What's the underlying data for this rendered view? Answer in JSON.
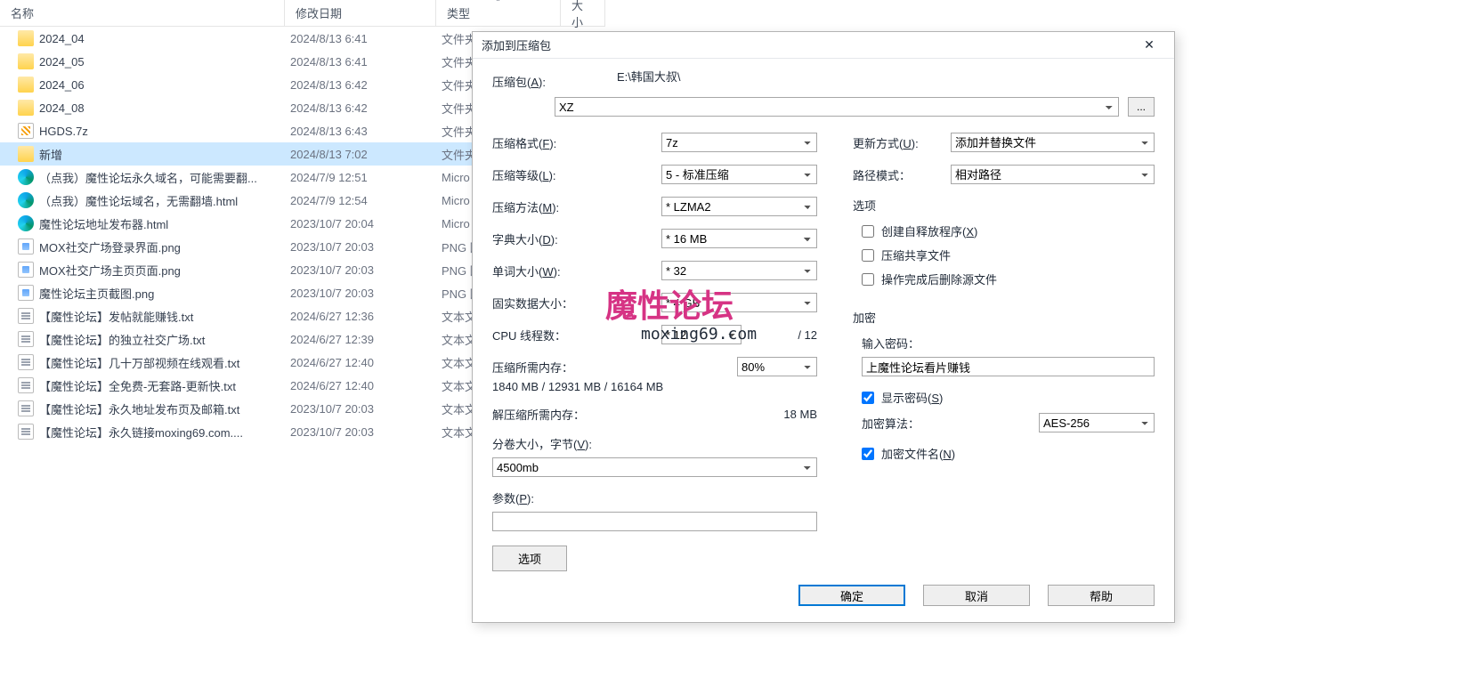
{
  "explorer": {
    "columns": {
      "name": "名称",
      "date": "修改日期",
      "type": "类型",
      "size": "大小"
    },
    "rows": [
      {
        "icon": "folder",
        "name": "2024_04",
        "date": "2024/8/13 6:41",
        "type": "文件夹",
        "sel": false
      },
      {
        "icon": "folder",
        "name": "2024_05",
        "date": "2024/8/13 6:41",
        "type": "文件夹",
        "sel": false
      },
      {
        "icon": "folder",
        "name": "2024_06",
        "date": "2024/8/13 6:42",
        "type": "文件夹",
        "sel": false
      },
      {
        "icon": "folder",
        "name": "2024_08",
        "date": "2024/8/13 6:42",
        "type": "文件夹",
        "sel": false
      },
      {
        "icon": "7z",
        "name": "HGDS.7z",
        "date": "2024/8/13 6:43",
        "type": "文件夹",
        "sel": false
      },
      {
        "icon": "folder",
        "name": "新增",
        "date": "2024/8/13 7:02",
        "type": "文件夹",
        "sel": true
      },
      {
        "icon": "edge",
        "name": "（点我）魔性论坛永久域名，可能需要翻...",
        "date": "2024/7/9 12:51",
        "type": "Micro",
        "sel": false
      },
      {
        "icon": "edge",
        "name": "（点我）魔性论坛域名，无需翻墙.html",
        "date": "2024/7/9 12:54",
        "type": "Micro",
        "sel": false
      },
      {
        "icon": "edge",
        "name": "魔性论坛地址发布器.html",
        "date": "2023/10/7 20:04",
        "type": "Micro",
        "sel": false
      },
      {
        "icon": "png",
        "name": "MOX社交广场登录界面.png",
        "date": "2023/10/7 20:03",
        "type": "PNG 图",
        "sel": false
      },
      {
        "icon": "png",
        "name": "MOX社交广场主页页面.png",
        "date": "2023/10/7 20:03",
        "type": "PNG 图",
        "sel": false
      },
      {
        "icon": "png",
        "name": "魔性论坛主页截图.png",
        "date": "2023/10/7 20:03",
        "type": "PNG 图",
        "sel": false
      },
      {
        "icon": "txt",
        "name": "【魔性论坛】发帖就能赚钱.txt",
        "date": "2024/6/27 12:36",
        "type": "文本文",
        "sel": false
      },
      {
        "icon": "txt",
        "name": "【魔性论坛】的独立社交广场.txt",
        "date": "2024/6/27 12:39",
        "type": "文本文",
        "sel": false
      },
      {
        "icon": "txt",
        "name": "【魔性论坛】几十万部视频在线观看.txt",
        "date": "2024/6/27 12:40",
        "type": "文本文",
        "sel": false
      },
      {
        "icon": "txt",
        "name": "【魔性论坛】全免费-无套路-更新快.txt",
        "date": "2024/6/27 12:40",
        "type": "文本文",
        "sel": false
      },
      {
        "icon": "txt",
        "name": "【魔性论坛】永久地址发布页及邮箱.txt",
        "date": "2023/10/7 20:03",
        "type": "文本文",
        "sel": false
      },
      {
        "icon": "txt",
        "name": "【魔性论坛】永久链接moxing69.com....",
        "date": "2023/10/7 20:03",
        "type": "文本文",
        "sel": false
      }
    ]
  },
  "dialog": {
    "title": "添加到压缩包",
    "archive_label": "压缩包",
    "archive_hotkey": "A",
    "archive_path": "E:\\韩国大叔\\",
    "archive_name": "XZ",
    "browse_btn": "...",
    "left": {
      "format_label": "压缩格式",
      "format_hk": "F",
      "format_val": "7z",
      "level_label": "压缩等级",
      "level_hk": "L",
      "level_val": "5 - 标准压缩",
      "method_label": "压缩方法",
      "method_hk": "M",
      "method_val": "* LZMA2",
      "dict_label": "字典大小",
      "dict_hk": "D",
      "dict_val": "* 16 MB",
      "word_label": "单词大小",
      "word_hk": "W",
      "word_val": "* 32",
      "solid_label": "固实数据大小：",
      "solid_val": "* 4 GB",
      "threads_label": "CPU 线程数：",
      "threads_val": "* 12",
      "threads_max": "/ 12",
      "mem_comp_label": "压缩所需内存：",
      "mem_comp_val": "1840 MB / 12931 MB / 16164 MB",
      "mem_pct": "80%",
      "mem_decomp_label": "解压缩所需内存：",
      "mem_decomp_val": "18 MB",
      "split_label": "分卷大小，字节",
      "split_hk": "V",
      "split_val": "4500mb",
      "params_label": "参数",
      "params_hk": "P",
      "params_val": "",
      "options_btn": "选项"
    },
    "right": {
      "update_label": "更新方式",
      "update_hk": "U",
      "update_val": "添加并替换文件",
      "path_label": "路径模式：",
      "path_val": "相对路径",
      "options_head": "选项",
      "sfx_label": "创建自释放程序",
      "sfx_hk": "X",
      "sfx_chk": false,
      "shared_label": "压缩共享文件",
      "shared_chk": false,
      "delete_label": "操作完成后删除源文件",
      "delete_chk": false,
      "enc_head": "加密",
      "pw_label": "输入密码：",
      "pw_val": "上魔性论坛看片赚钱",
      "show_pw_label": "显示密码",
      "show_pw_hk": "S",
      "show_pw_chk": true,
      "enc_method_label": "加密算法：",
      "enc_method_val": "AES-256",
      "enc_names_label": "加密文件名",
      "enc_names_hk": "N",
      "enc_names_chk": true
    },
    "btns": {
      "ok": "确定",
      "cancel": "取消",
      "help": "帮助"
    }
  },
  "watermark": {
    "main": "魔性论坛",
    "sub": "moxing69.com"
  }
}
